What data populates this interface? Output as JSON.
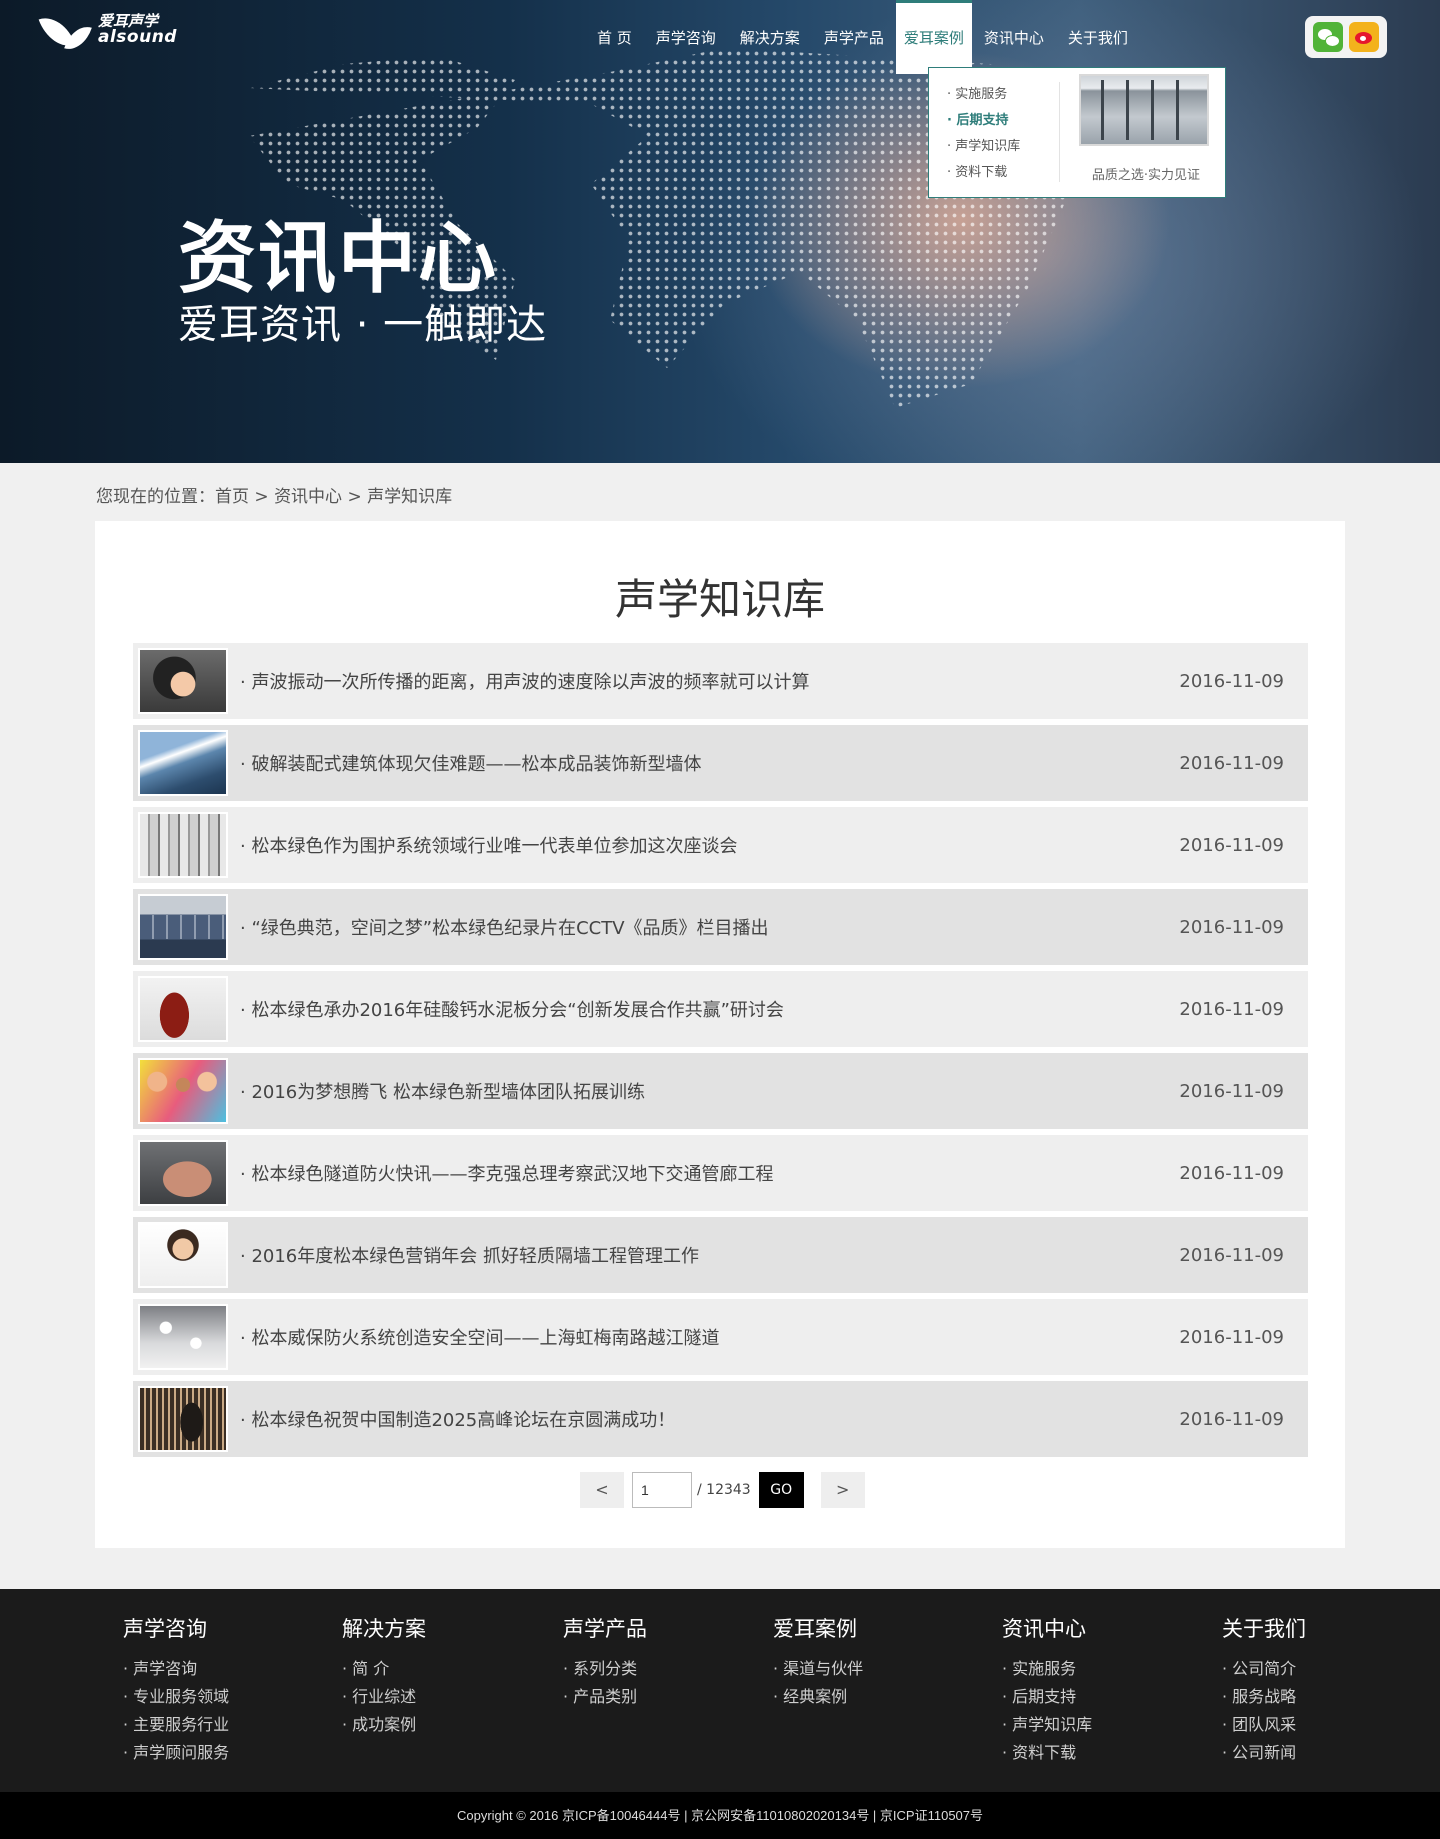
{
  "header": {
    "logo_cn": "爱耳声学",
    "logo_en": "alsound",
    "nav": [
      {
        "label": "首 页"
      },
      {
        "label": "声学咨询"
      },
      {
        "label": "解决方案"
      },
      {
        "label": "声学产品"
      },
      {
        "label": "爱耳案例"
      },
      {
        "label": "资讯中心"
      },
      {
        "label": "关于我们"
      }
    ],
    "active_nav": "爱耳案例",
    "social_icons": [
      "wechat-icon",
      "weibo-icon"
    ]
  },
  "dropdown": {
    "items": [
      "· 实施服务",
      "· 后期支持",
      "· 声学知识库",
      "· 资料下载"
    ],
    "highlighted": "· 后期支持",
    "caption": "品质之选·实力见证"
  },
  "hero": {
    "title": "资讯中心",
    "subtitle": "爱耳资讯 · 一触即达"
  },
  "breadcrumb": {
    "prefix": "您现在的位置：",
    "items": [
      "首页",
      "资讯中心",
      "声学知识库"
    ],
    "separator": " > "
  },
  "main": {
    "title": "声学知识库",
    "news": [
      {
        "title": "· 声波振动一次所传播的距离，用声波的速度除以声波的频率就可以计算",
        "date": "2016-11-09"
      },
      {
        "title": "· 破解装配式建筑体现欠佳难题——松本成品装饰新型墙体",
        "date": "2016-11-09"
      },
      {
        "title": "· 松本绿色作为围护系统领域行业唯一代表单位参加这次座谈会",
        "date": "2016-11-09"
      },
      {
        "title": "· “绿色典范，空间之梦”松本绿色纪录片在CCTV《品质》栏目播出",
        "date": "2016-11-09"
      },
      {
        "title": "· 松本绿色承办2016年硅酸钙水泥板分会“创新发展合作共赢”研讨会",
        "date": "2016-11-09"
      },
      {
        "title": "· 2016为梦想腾飞 松本绿色新型墙体团队拓展训练",
        "date": "2016-11-09"
      },
      {
        "title": "· 松本绿色隧道防火快讯——李克强总理考察武汉地下交通管廊工程",
        "date": "2016-11-09"
      },
      {
        "title": "· 2016年度松本绿色营销年会 抓好轻质隔墙工程管理工作",
        "date": "2016-11-09"
      },
      {
        "title": "· 松本威保防火系统创造安全空间——上海虹梅南路越江隧道",
        "date": "2016-11-09"
      },
      {
        "title": "· 松本绿色祝贺中国制造2025高峰论坛在京圆满成功！",
        "date": "2016-11-09"
      }
    ]
  },
  "pagination": {
    "prev": "<",
    "current": "1",
    "total": "/ 12343",
    "go": "GO",
    "next": ">"
  },
  "footer": {
    "columns": [
      {
        "title": "声学咨询",
        "links": [
          "· 声学咨询",
          "· 专业服务领域",
          "· 主要服务行业",
          "· 声学顾问服务"
        ]
      },
      {
        "title": "解决方案",
        "links": [
          "· 简 介",
          "· 行业综述",
          "· 成功案例"
        ]
      },
      {
        "title": "声学产品",
        "links": [
          "· 系列分类",
          "· 产品类别"
        ]
      },
      {
        "title": "爱耳案例",
        "links": [
          "· 渠道与伙伴",
          "· 经典案例"
        ]
      },
      {
        "title": "资讯中心",
        "links": [
          "· 实施服务",
          "· 后期支持",
          "· 声学知识库",
          "· 资料下载"
        ]
      },
      {
        "title": "关于我们",
        "links": [
          "· 公司简介",
          "· 服务战略",
          "· 团队风采",
          "· 公司新闻"
        ]
      }
    ],
    "copyright": "Copyright © 2016  京ICP备10046444号 | 京公网安备11010802020134号 | 京ICP证110507号"
  },
  "colors": {
    "accent": "#2e7d7a",
    "footer_bg": "#1b1b1b",
    "copyright_bg": "#000000",
    "row_light": "#eeeeee",
    "row_dark": "#e2e2e2"
  }
}
